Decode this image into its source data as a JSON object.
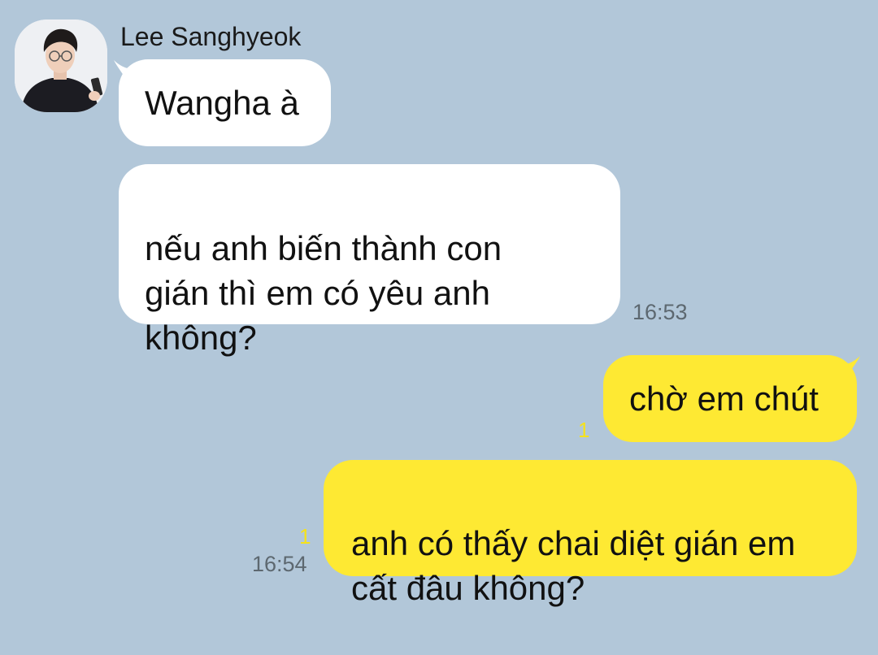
{
  "chat": {
    "sender": {
      "name": "Lee Sanghyeok",
      "avatar": "avatar-photo-icon"
    },
    "incoming": [
      {
        "text": "Wangha à"
      },
      {
        "text": "nếu anh biến thành con\ngián thì em có yêu anh\nkhông?",
        "time": "16:53"
      }
    ],
    "outgoing": [
      {
        "text": "chờ em chút",
        "unread": "1"
      },
      {
        "text": "anh có thấy chai diệt gián em\ncất đâu không?",
        "unread": "1",
        "time": "16:54"
      }
    ]
  },
  "colors": {
    "background": "#b2c7d9",
    "incoming_bubble": "#ffffff",
    "outgoing_bubble": "#fee933",
    "unread_counter": "#f5e21b",
    "timestamp": "#5d6870"
  }
}
